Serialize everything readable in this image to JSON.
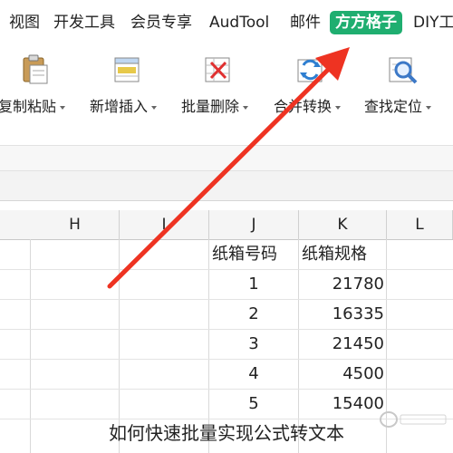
{
  "ribbon": {
    "tabs": [
      "视图",
      "开发工具",
      "会员专享",
      "AudTool",
      "邮件",
      "方方格子",
      "DIY工"
    ]
  },
  "toolbar": {
    "buttons": [
      "复制粘贴",
      "新增插入",
      "批量删除",
      "合并转换",
      "查找定位"
    ]
  },
  "columns": [
    "H",
    "I",
    "J",
    "K",
    "L"
  ],
  "table": {
    "headers": [
      "纸箱号码",
      "纸箱规格"
    ],
    "rows": [
      [
        "1",
        "21780"
      ],
      [
        "2",
        "16335"
      ],
      [
        "3",
        "21450"
      ],
      [
        "4",
        "4500"
      ],
      [
        "5",
        "15400"
      ]
    ]
  },
  "caption": "如何快速批量实现公式转文本",
  "colors": {
    "active_tab": "#1fae70",
    "arrow": "#ee3322"
  }
}
